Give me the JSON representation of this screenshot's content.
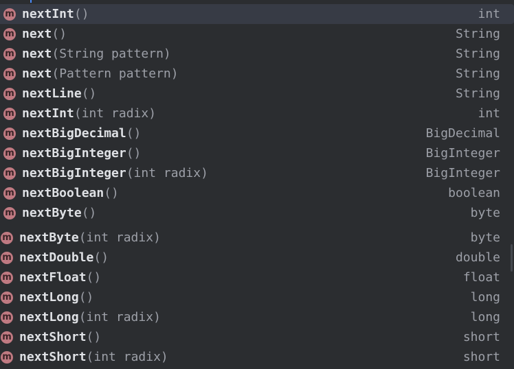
{
  "completion": {
    "icon_letter": "m",
    "items": [
      {
        "name": "nextInt",
        "params": "()",
        "type": "int",
        "selected": true
      },
      {
        "name": "next",
        "params": "()",
        "type": "String"
      },
      {
        "name": "next",
        "params": "(String pattern)",
        "type": "String"
      },
      {
        "name": "next",
        "params": "(Pattern pattern)",
        "type": "String"
      },
      {
        "name": "nextLine",
        "params": "()",
        "type": "String"
      },
      {
        "name": "nextInt",
        "params": "(int radix)",
        "type": "int"
      },
      {
        "name": "nextBigDecimal",
        "params": "()",
        "type": "BigDecimal"
      },
      {
        "name": "nextBigInteger",
        "params": "()",
        "type": "BigInteger"
      },
      {
        "name": "nextBigInteger",
        "params": "(int radix)",
        "type": "BigInteger"
      },
      {
        "name": "nextBoolean",
        "params": "()",
        "type": "boolean"
      },
      {
        "name": "nextByte",
        "params": "()",
        "type": "byte"
      },
      {
        "name": "nextByte",
        "params": "(int radix)",
        "type": "byte"
      },
      {
        "name": "nextDouble",
        "params": "()",
        "type": "double"
      },
      {
        "name": "nextFloat",
        "params": "()",
        "type": "float"
      },
      {
        "name": "nextLong",
        "params": "()",
        "type": "long"
      },
      {
        "name": "nextLong",
        "params": "(int radix)",
        "type": "long"
      },
      {
        "name": "nextShort",
        "params": "()",
        "type": "short"
      },
      {
        "name": "nextShort",
        "params": "(int radix)",
        "type": "short"
      }
    ]
  },
  "colors": {
    "background": "#2b2d30",
    "selection": "#373b45",
    "method_icon": "#c07a82",
    "method_name": "#dfe1e5",
    "params_and_type": "#9da0a8"
  },
  "icons": {
    "method": "method-m-icon"
  }
}
